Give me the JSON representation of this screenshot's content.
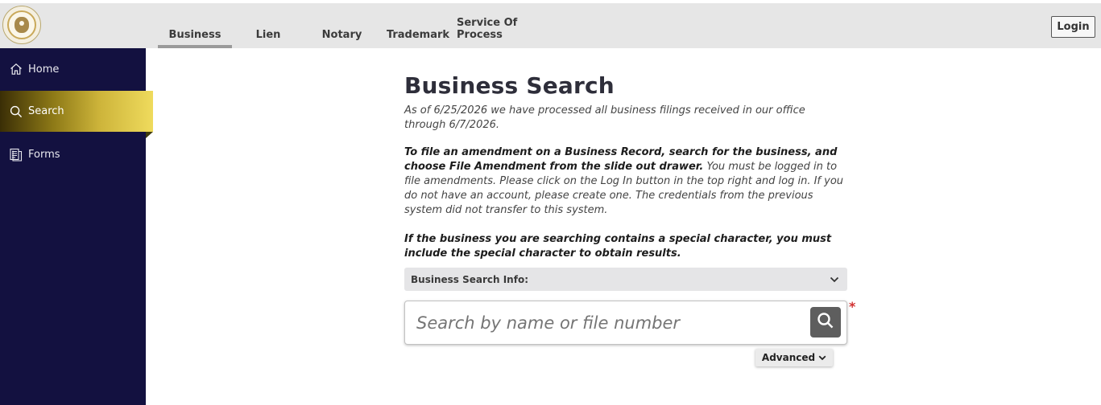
{
  "header": {
    "logo_icon": "state-seal-icon",
    "tabs": [
      {
        "label": "Business",
        "active": true
      },
      {
        "label": "Lien",
        "active": false
      },
      {
        "label": "Notary",
        "active": false
      },
      {
        "label": "Trademark",
        "active": false
      },
      {
        "label": "Service Of Process",
        "active": false
      }
    ],
    "login_label": "Login"
  },
  "sidebar": {
    "items": [
      {
        "label": "Home",
        "icon": "home-icon",
        "active": false
      },
      {
        "label": "Search",
        "icon": "search-icon",
        "active": true
      },
      {
        "label": "Forms",
        "icon": "forms-icon",
        "active": false
      }
    ],
    "background": "#131140",
    "active_gradient": [
      "#3a2e06",
      "#efdb5d"
    ]
  },
  "main": {
    "title": "Business Search",
    "processed_notice": "As of 6/25/2026 we have processed all business filings received in our office through 6/7/2026.",
    "amendment_bold": "To file an amendment on a Business Record, search for the business, and choose File Amendment from the slide out drawer.",
    "amendment_rest": " You must be logged in to file amendments. Please click on the Log In button in the top right and log in. If you do not have an account, please create one. The credentials from the previous system did not transfer to this system.",
    "special_char_notice": "If the business you are searching contains a special character, you must include the special character to obtain results.",
    "info_label": "Business Search Info:",
    "search": {
      "placeholder": "Search by name or file number",
      "value": "",
      "required_mark": "*"
    },
    "advanced_label": "Advanced"
  }
}
